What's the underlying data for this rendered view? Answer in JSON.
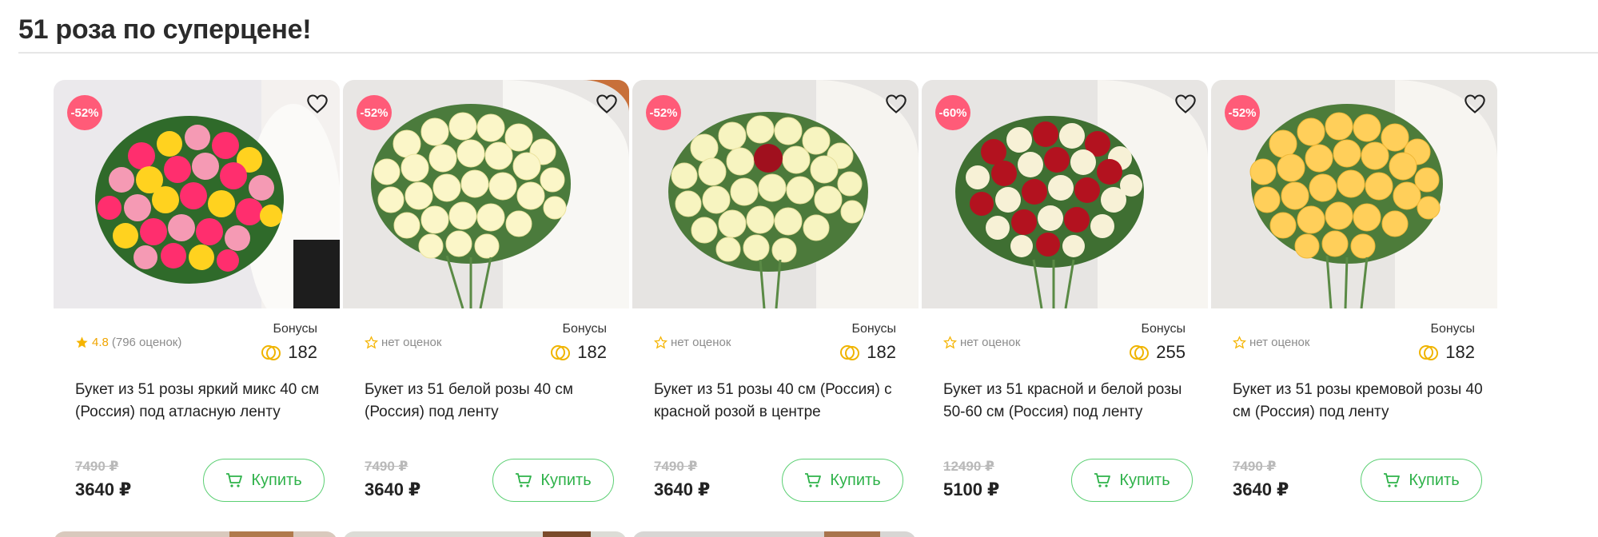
{
  "section": {
    "title": "51 роза по суперцене!"
  },
  "cards": [
    {
      "discount": "-52%",
      "rating_value": "4.8",
      "rating_count": "(796 оценок)",
      "rating_empty": "",
      "bonus_label": "Бонусы",
      "bonus": "182",
      "name": "Букет из 51 розы яркий микс 40 см (Россия) под атласную ленту",
      "old_price": "7490 ₽",
      "price": "3640 ₽",
      "buy_label": "Купить"
    },
    {
      "discount": "-52%",
      "rating_value": "",
      "rating_count": "",
      "rating_empty": "нет оценок",
      "bonus_label": "Бонусы",
      "bonus": "182",
      "name": "Букет из 51 белой розы 40 см (Россия) под ленту",
      "old_price": "7490 ₽",
      "price": "3640 ₽",
      "buy_label": "Купить"
    },
    {
      "discount": "-52%",
      "rating_value": "",
      "rating_count": "",
      "rating_empty": "нет оценок",
      "bonus_label": "Бонусы",
      "bonus": "182",
      "name": "Букет из 51 розы 40 см (Россия) с красной розой в центре",
      "old_price": "7490 ₽",
      "price": "3640 ₽",
      "buy_label": "Купить"
    },
    {
      "discount": "-60%",
      "rating_value": "",
      "rating_count": "",
      "rating_empty": "нет оценок",
      "bonus_label": "Бонусы",
      "bonus": "255",
      "name": "Букет из 51 красной и белой розы 50-60 см (Россия) под ленту",
      "old_price": "12490 ₽",
      "price": "5100 ₽",
      "buy_label": "Купить"
    },
    {
      "discount": "-52%",
      "rating_value": "",
      "rating_count": "",
      "rating_empty": "нет оценок",
      "bonus_label": "Бонусы",
      "bonus": "182",
      "name": "Букет из 51 розы кремовой розы 40 см (Россия) под ленту",
      "old_price": "7490 ₽",
      "price": "3640 ₽",
      "buy_label": "Купить"
    }
  ],
  "colors": {
    "badge": "#ff5b78",
    "buy_accent": "#2fb24a",
    "star": "#f0a500"
  }
}
